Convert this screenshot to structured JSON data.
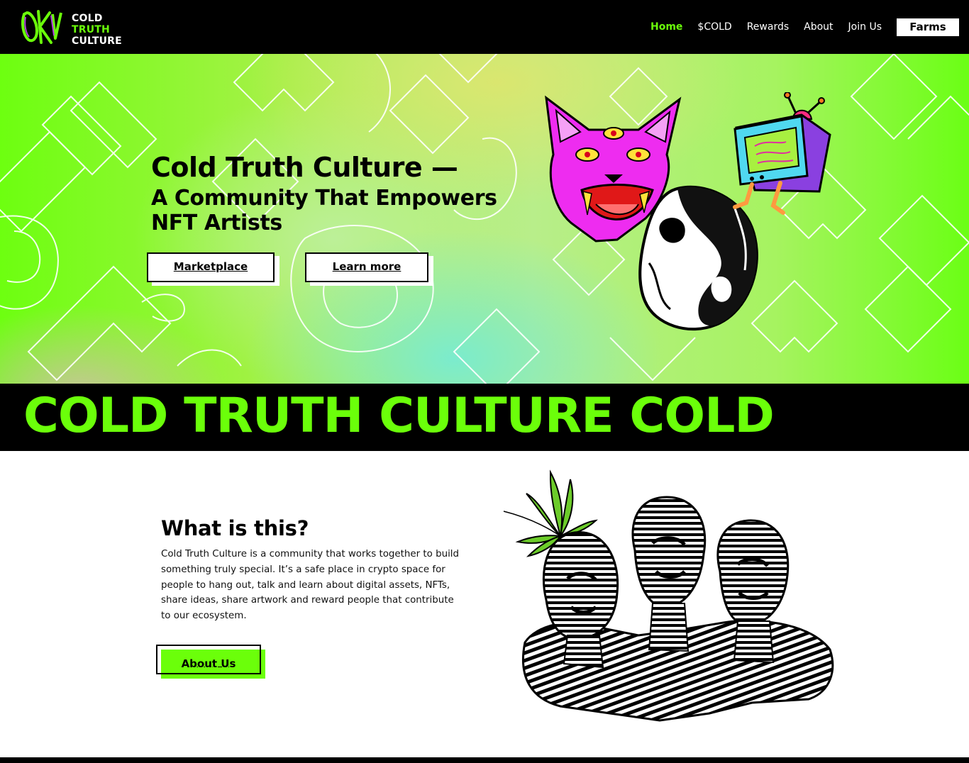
{
  "brand": {
    "line1": "COLD",
    "line2": "TRUTH",
    "line3": "CULTURE"
  },
  "nav": {
    "items": [
      "Home",
      "$COLD",
      "Rewards",
      "About",
      "Join Us"
    ],
    "cta": "Farms"
  },
  "hero": {
    "title": "Cold Truth Culture —",
    "subtitle": "A Community That Empowers NFT Artists",
    "primary_button": "Marketplace",
    "secondary_button": "Learn more"
  },
  "marquee": {
    "text": "COLD TRUTH CULTURE COLD"
  },
  "about": {
    "title": "What is this?",
    "body": "Cold Truth Culture is a community that works together to build something truly special. It’s a safe place in crypto space for people to hang out, talk and learn about digital assets, NFTs, share ideas, share artwork and reward people that contribute to our ecosystem.",
    "button": "About Us"
  },
  "colors": {
    "accent": "#6bff0a",
    "dark": "#000000",
    "magenta": "#e020f0"
  }
}
